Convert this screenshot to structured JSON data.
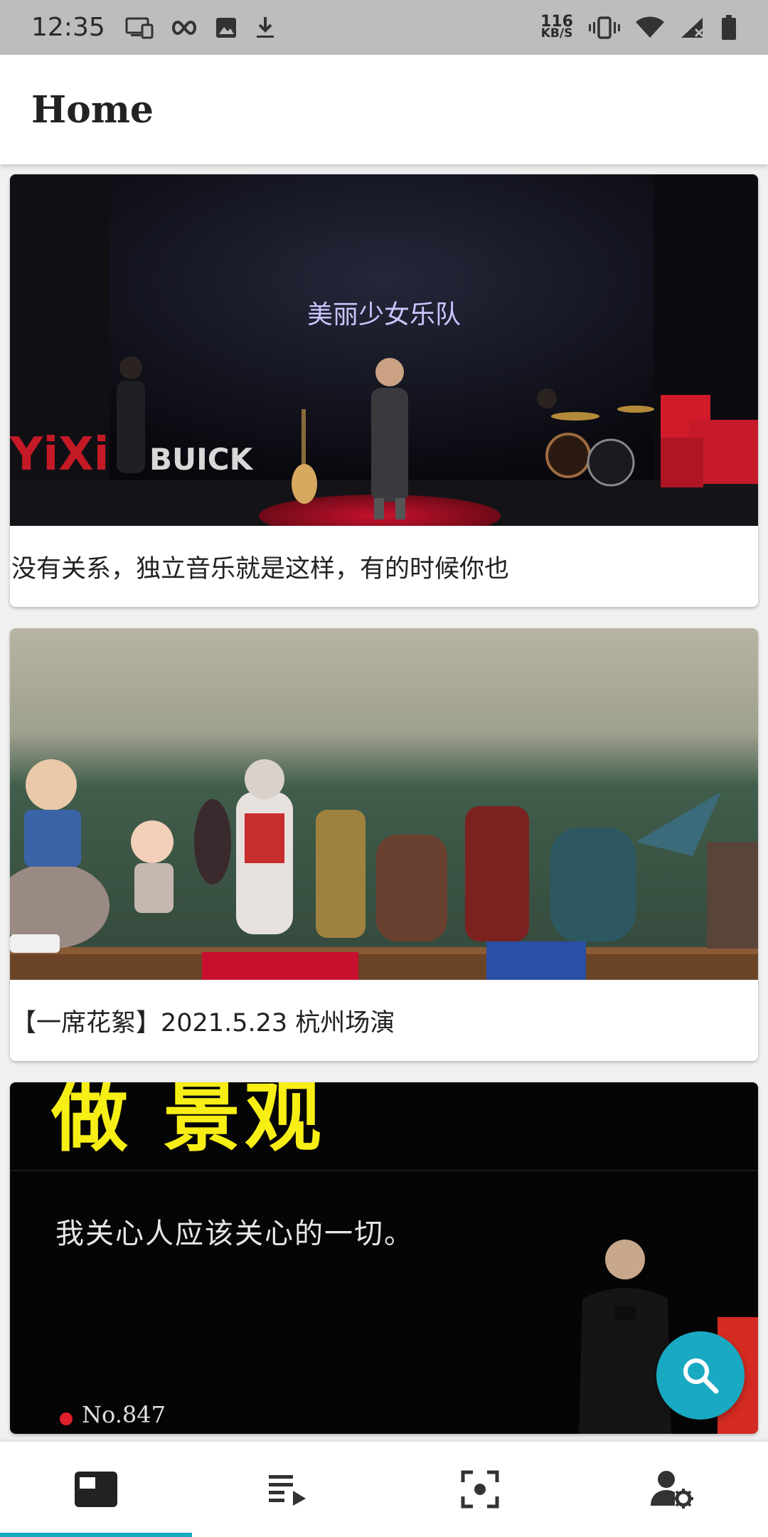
{
  "status_bar": {
    "time": "12:35",
    "speed_value": "116",
    "speed_unit": "KB/S",
    "left_icons": [
      "cast-icon",
      "infinity-icon",
      "image-icon",
      "download-icon"
    ],
    "right_icons": [
      "vibrate-icon",
      "wifi-icon",
      "signal-icon",
      "battery-icon"
    ]
  },
  "app_bar": {
    "title": "Home"
  },
  "feed": {
    "cards": [
      {
        "title": "没有关系，独立音乐就是这样，有的时候你也",
        "overlay_text": "美丽少女乐队",
        "stage_logo": "BUICK",
        "stage_logo_left": "YiXi"
      },
      {
        "title": "【一席花絮】2021.5.23 杭州场演",
        "overlay_text": ""
      },
      {
        "title": "",
        "heading_text": "做 景观",
        "overlay_text": "我关心人应该关心的一切。",
        "episode": "No.847"
      }
    ]
  },
  "fab": {
    "icon": "search-icon"
  },
  "bottom_nav": {
    "items": [
      {
        "icon": "home-feed-icon",
        "active": true
      },
      {
        "icon": "playlist-icon",
        "active": false
      },
      {
        "icon": "scan-icon",
        "active": false
      },
      {
        "icon": "account-settings-icon",
        "active": false
      }
    ]
  },
  "colors": {
    "accent": "#1aa9c2",
    "status_bar": "#bdbdbd",
    "title_text": "#222222"
  }
}
